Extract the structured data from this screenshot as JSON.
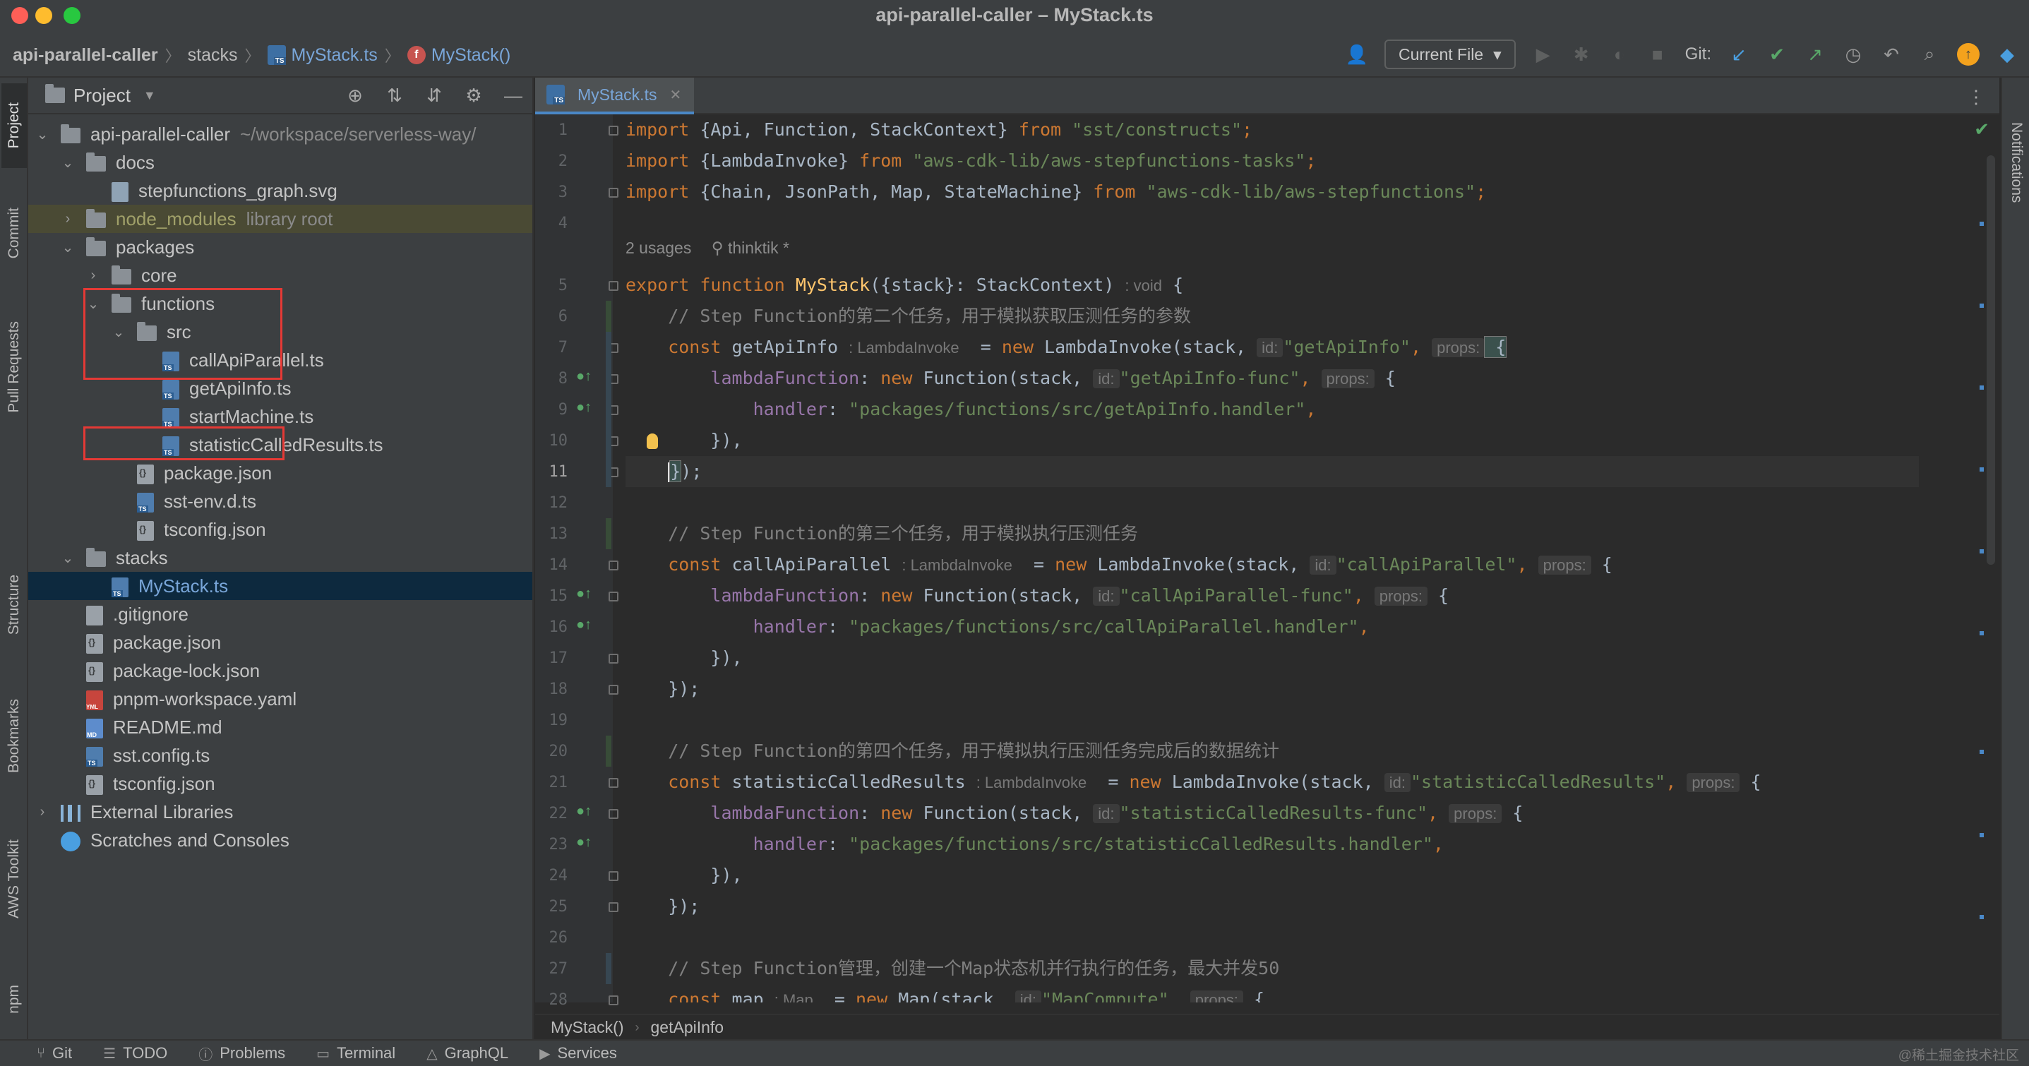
{
  "window": {
    "title": "api-parallel-caller – MyStack.ts"
  },
  "navbar": {
    "breadcrumbs": [
      "api-parallel-caller",
      "stacks",
      "MyStack.ts",
      "MyStack()"
    ],
    "run_config": "Current File",
    "git_label": "Git:",
    "icons": [
      "user-icon",
      "run-icon",
      "debug-icon",
      "coverage-icon",
      "stop-icon",
      "vcs-update-icon",
      "vcs-commit-icon",
      "vcs-push-icon",
      "history-icon",
      "rollback-icon",
      "search-icon",
      "updates-icon",
      "toolbox-icon"
    ]
  },
  "left_strip": {
    "tabs": [
      "Project",
      "Commit",
      "Pull Requests",
      "Structure",
      "Bookmarks",
      "AWS Toolkit",
      "npm"
    ],
    "aws_label": "aws"
  },
  "right_strip": {
    "tabs": [
      "Notifications"
    ]
  },
  "project": {
    "title": "Project",
    "tree": [
      {
        "label": "api-parallel-caller",
        "hint": "~/workspace/serverless-way/",
        "kind": "folder",
        "depth": 0,
        "expanded": true
      },
      {
        "label": "docs",
        "kind": "folder",
        "depth": 1,
        "expanded": true
      },
      {
        "label": "stepfunctions_graph.svg",
        "kind": "svg",
        "depth": 2
      },
      {
        "label": "node_modules",
        "hint": "library root",
        "kind": "folder",
        "depth": 1,
        "expanded": false,
        "excluded": true
      },
      {
        "label": "packages",
        "kind": "folder",
        "depth": 1,
        "expanded": true
      },
      {
        "label": "core",
        "kind": "folder",
        "depth": 2,
        "expanded": false
      },
      {
        "label": "functions",
        "kind": "folder",
        "depth": 2,
        "expanded": true
      },
      {
        "label": "src",
        "kind": "folder",
        "depth": 3,
        "expanded": true
      },
      {
        "label": "callApiParallel.ts",
        "kind": "ts",
        "depth": 4
      },
      {
        "label": "getApiInfo.ts",
        "kind": "ts",
        "depth": 4
      },
      {
        "label": "startMachine.ts",
        "kind": "ts",
        "depth": 4
      },
      {
        "label": "statisticCalledResults.ts",
        "kind": "ts",
        "depth": 4
      },
      {
        "label": "package.json",
        "kind": "json",
        "depth": 3
      },
      {
        "label": "sst-env.d.ts",
        "kind": "ts",
        "depth": 3
      },
      {
        "label": "tsconfig.json",
        "kind": "json",
        "depth": 3
      },
      {
        "label": "stacks",
        "kind": "folder",
        "depth": 1,
        "expanded": true
      },
      {
        "label": "MyStack.ts",
        "kind": "ts",
        "depth": 2,
        "selected": true
      },
      {
        "label": ".gitignore",
        "kind": "git",
        "depth": 1
      },
      {
        "label": "package.json",
        "kind": "json",
        "depth": 1
      },
      {
        "label": "package-lock.json",
        "kind": "json",
        "depth": 1
      },
      {
        "label": "pnpm-workspace.yaml",
        "kind": "yml",
        "depth": 1
      },
      {
        "label": "README.md",
        "kind": "md",
        "depth": 1
      },
      {
        "label": "sst.config.ts",
        "kind": "ts",
        "depth": 1
      },
      {
        "label": "tsconfig.json",
        "kind": "json",
        "depth": 1
      },
      {
        "label": "External Libraries",
        "kind": "lib",
        "depth": 0,
        "expanded": false
      },
      {
        "label": "Scratches and Consoles",
        "kind": "scratch",
        "depth": 0
      }
    ]
  },
  "editor": {
    "tab": {
      "label": "MyStack.ts"
    },
    "usages": {
      "count": "2 usages",
      "author": "thinktik *"
    },
    "line_numbers": [
      "1",
      "2",
      "3",
      "4",
      "5",
      "6",
      "7",
      "8",
      "9",
      "10",
      "11",
      "12",
      "13",
      "14",
      "15",
      "16",
      "17",
      "18",
      "19",
      "20",
      "21",
      "22",
      "23",
      "24",
      "25",
      "26",
      "27",
      "28"
    ],
    "current_line": "11",
    "code": {
      "l1": {
        "a": "import ",
        "b": "{Api, Function, StackContext} ",
        "c": "from ",
        "d": "\"sst/constructs\"",
        "e": ";"
      },
      "l2": {
        "a": "import ",
        "b": "{LambdaInvoke} ",
        "c": "from ",
        "d": "\"aws-cdk-lib/aws-stepfunctions-tasks\"",
        "e": ";"
      },
      "l3": {
        "a": "import ",
        "b": "{Chain, JsonPath, Map, StateMachine} ",
        "c": "from ",
        "d": "\"aws-cdk-lib/aws-stepfunctions\"",
        "e": ";"
      },
      "l5": {
        "a": "export function ",
        "b": "MyStack",
        "c": "({stack}: StackContext) ",
        "hint": ": void",
        "d": " {"
      },
      "l6": {
        "c": "    // Step Function的第二个任务，用于模拟获取压测任务的参数"
      },
      "l7": {
        "a": "    const ",
        "b": "getApiInfo ",
        "t": ": LambdaInvoke",
        "c": "  = ",
        "d": "new ",
        "e": "LambdaInvoke(stack, ",
        "id": "id:",
        "s": "\"getApiInfo\"",
        "f": ", ",
        "pr": "props:",
        "g": " {"
      },
      "l8": {
        "a": "        lambdaFunction",
        "b": ": ",
        "c": "new ",
        "d": "Function(stack, ",
        "id": "id:",
        "s": "\"getApiInfo-func\"",
        "f": ", ",
        "pr": "props:",
        "g": " {"
      },
      "l9": {
        "a": "            handler",
        "b": ": ",
        "s": "\"packages/functions/src/getApiInfo.handler\"",
        "g": ","
      },
      "l10": {
        "a": "        }),"
      },
      "l11": {
        "a": "    ",
        "b": "}",
        "c": ");"
      },
      "l13": {
        "c": "    // Step Function的第三个任务，用于模拟执行压测任务"
      },
      "l14": {
        "a": "    const ",
        "b": "callApiParallel ",
        "t": ": LambdaInvoke",
        "c": "  = ",
        "d": "new ",
        "e": "LambdaInvoke(stack, ",
        "id": "id:",
        "s": "\"callApiParallel\"",
        "f": ", ",
        "pr": "props:",
        "g": " {"
      },
      "l15": {
        "a": "        lambdaFunction",
        "b": ": ",
        "c": "new ",
        "d": "Function(stack, ",
        "id": "id:",
        "s": "\"callApiParallel-func\"",
        "f": ", ",
        "pr": "props:",
        "g": " {"
      },
      "l16": {
        "a": "            handler",
        "b": ": ",
        "s": "\"packages/functions/src/callApiParallel.handler\"",
        "g": ","
      },
      "l17": {
        "a": "        }),"
      },
      "l18": {
        "a": "    });"
      },
      "l20": {
        "c": "    // Step Function的第四个任务，用于模拟执行压测任务完成后的数据统计"
      },
      "l21": {
        "a": "    const ",
        "b": "statisticCalledResults ",
        "t": ": LambdaInvoke",
        "c": "  = ",
        "d": "new ",
        "e": "LambdaInvoke(stack, ",
        "id": "id:",
        "s": "\"statisticCalledResults\"",
        "f": ", ",
        "pr": "props:",
        "g": " {"
      },
      "l22": {
        "a": "        lambdaFunction",
        "b": ": ",
        "c": "new ",
        "d": "Function(stack, ",
        "id": "id:",
        "s": "\"statisticCalledResults-func\"",
        "f": ", ",
        "pr": "props:",
        "g": " {"
      },
      "l23": {
        "a": "            handler",
        "b": ": ",
        "s": "\"packages/functions/src/statisticCalledResults.handler\"",
        "g": ","
      },
      "l24": {
        "a": "        }),"
      },
      "l25": {
        "a": "    });"
      },
      "l27": {
        "c": "    // Step Function管理，创建一个Map状态机并行执行的任务，最大并发50"
      },
      "l28": {
        "a": "    const ",
        "b": "map ",
        "t": ": Map",
        "c": "  = ",
        "d": "new ",
        "e": "Map(stack, ",
        "id": "id:",
        "s": "\"MapCompute\"",
        "f": ", ",
        "pr": "props:",
        "g": " {"
      }
    },
    "breadcrumbs": [
      "MyStack()",
      "getApiInfo"
    ]
  },
  "bottom_bar": {
    "items": [
      {
        "label": "Git",
        "icon": "git-branch-icon"
      },
      {
        "label": "TODO",
        "icon": "todo-icon"
      },
      {
        "label": "Problems",
        "icon": "problems-icon"
      },
      {
        "label": "Terminal",
        "icon": "terminal-icon"
      },
      {
        "label": "GraphQL",
        "icon": "graphql-icon"
      },
      {
        "label": "Services",
        "icon": "services-icon"
      }
    ],
    "watermark": "@稀土掘金技术社区"
  },
  "colors": {
    "keyword": "#cc7832",
    "string": "#6a8759",
    "comment": "#808080",
    "function": "#ffc66d",
    "property": "#9876aa",
    "highlight_box": "#e53935",
    "selection": "#0d293e"
  }
}
